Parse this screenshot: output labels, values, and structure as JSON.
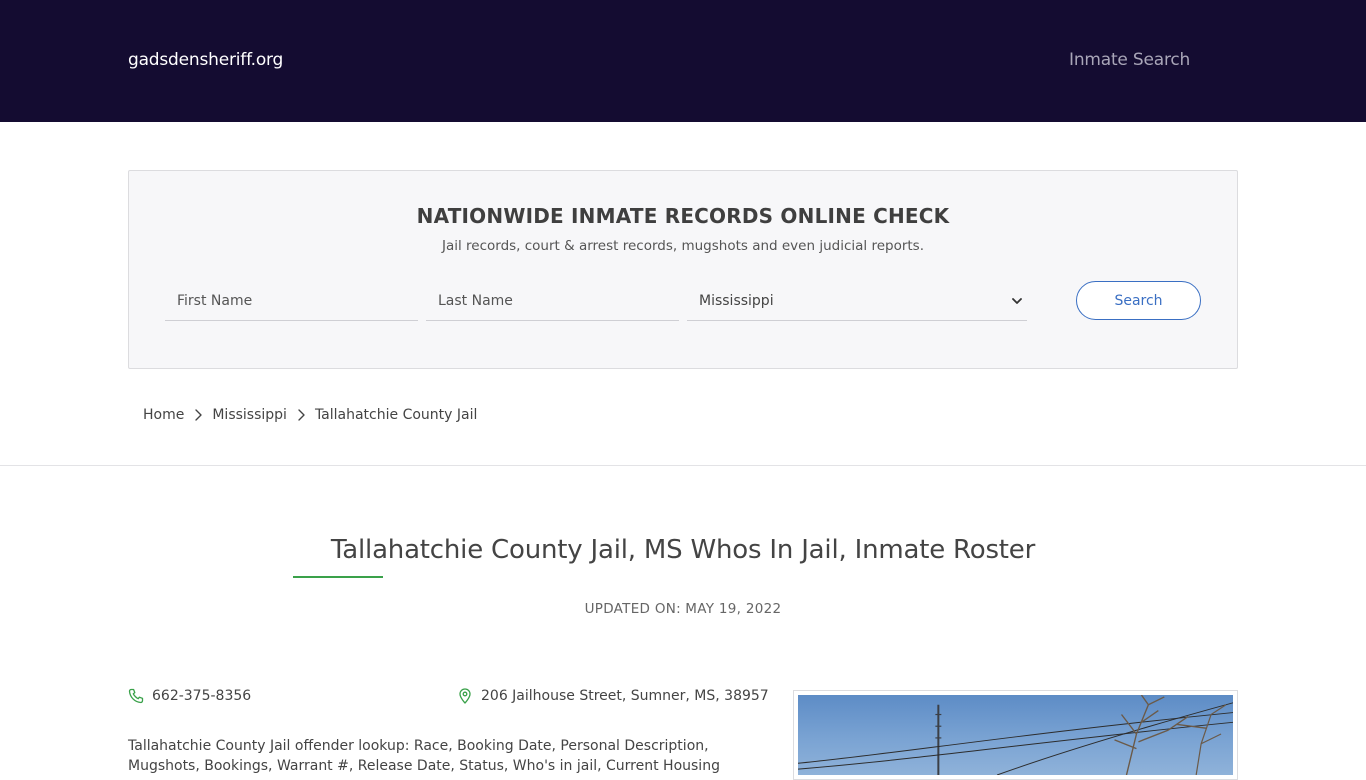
{
  "header": {
    "brand": "gadsdensheriff.org",
    "nav_link": "Inmate Search"
  },
  "search_panel": {
    "title": "NATIONWIDE INMATE RECORDS ONLINE CHECK",
    "subtitle": "Jail records, court & arrest records, mugshots and even judicial reports.",
    "first_name_placeholder": "First Name",
    "last_name_placeholder": "Last Name",
    "state_selected": "Mississippi",
    "search_label": "Search"
  },
  "breadcrumb": {
    "items": [
      "Home",
      "Mississippi",
      "Tallahatchie County Jail"
    ]
  },
  "page": {
    "title": "Tallahatchie County Jail, MS Whos In Jail, Inmate Roster",
    "updated_label": "UPDATED ON:",
    "updated_date": "MAY 19, 2022",
    "phone": "662-375-8356",
    "address": "206 Jailhouse Street, Sumner, MS, 38957",
    "description": "Tallahatchie County Jail offender lookup: Race, Booking Date, Personal Description, Mugshots, Bookings, Warrant #, Release Date, Status, Who's in jail, Current Housing"
  },
  "colors": {
    "header_bg": "#140c31",
    "accent_green": "#3aa14a",
    "button_blue": "#3a6fc3"
  },
  "icons": {
    "phone": "phone-icon",
    "address": "map-pin-icon",
    "select": "chevron-down-icon",
    "crumb": "chevron-right-icon"
  }
}
